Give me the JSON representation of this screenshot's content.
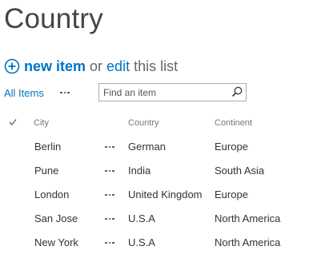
{
  "page": {
    "title": "Country"
  },
  "command": {
    "new_item_label": "new item",
    "or_text": "or",
    "edit_label": "edit",
    "this_list_text": "this list",
    "icon": "plus-circle-icon"
  },
  "view": {
    "all_items_label": "All Items",
    "more_icon": "ellipsis-icon"
  },
  "search": {
    "placeholder": "Find an item",
    "icon": "search-icon"
  },
  "table": {
    "headers": {
      "city": "City",
      "country": "Country",
      "continent": "Continent"
    },
    "rows": [
      {
        "city": "Berlin",
        "country": "German",
        "continent": "Europe"
      },
      {
        "city": "Pune",
        "country": "India",
        "continent": "South Asia"
      },
      {
        "city": "London",
        "country": "United Kingdom",
        "continent": "Europe"
      },
      {
        "city": "San Jose",
        "country": "U.S.A",
        "continent": "North America"
      },
      {
        "city": "New York",
        "country": "U.S.A",
        "continent": "North America"
      }
    ]
  },
  "colors": {
    "accent": "#0072c6",
    "text": "#333333",
    "muted": "#777777"
  }
}
